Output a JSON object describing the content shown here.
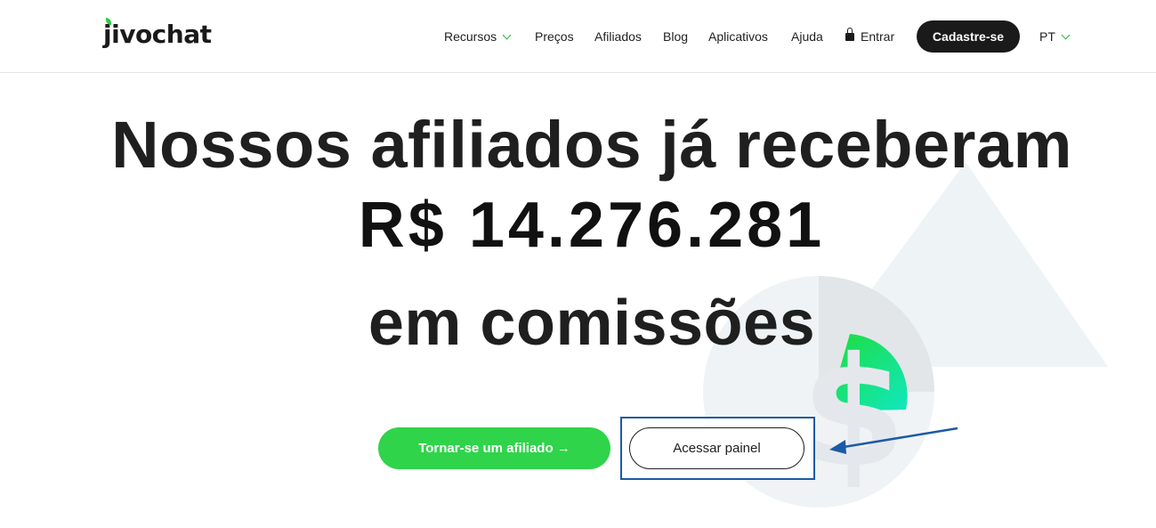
{
  "header": {
    "logo_text": "jivochat",
    "nav": [
      {
        "label": "Recursos",
        "dropdown": true
      },
      {
        "label": "Preços"
      },
      {
        "label": "Afiliados"
      },
      {
        "label": "Blog"
      },
      {
        "label": "Aplicativos"
      },
      {
        "label": "Ajuda"
      },
      {
        "label": "Entrar",
        "icon": "lock-icon"
      }
    ],
    "signup_label": "Cadastre-se",
    "language": "PT"
  },
  "hero": {
    "line1": "Nossos afiliados já receberam",
    "amount": "R$ 14.276.281",
    "line3": "em comissões"
  },
  "actions": {
    "affiliate_label": "Tornar-se um afiliado →",
    "panel_label": "Acessar painel"
  },
  "colors": {
    "accent_green": "#2fd44a",
    "dark": "#1a1a1a",
    "annotation_blue": "#1c5aa6"
  }
}
